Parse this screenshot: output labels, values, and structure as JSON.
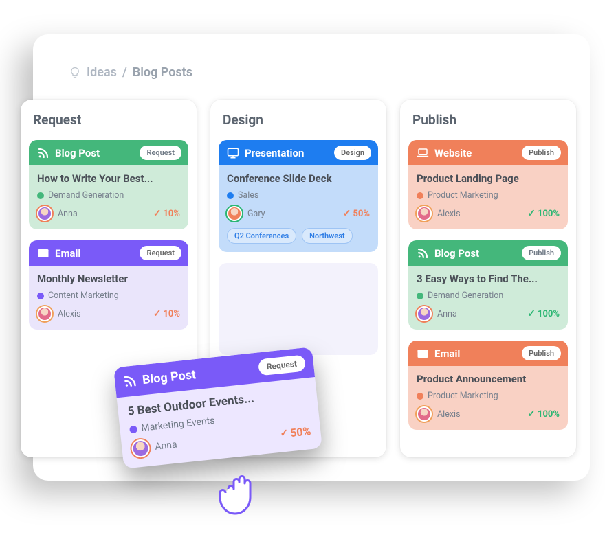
{
  "breadcrumb": {
    "root": "Ideas",
    "current": "Blog Posts"
  },
  "columns": [
    {
      "title": "Request"
    },
    {
      "title": "Design"
    },
    {
      "title": "Publish"
    }
  ],
  "cards": {
    "c0": {
      "type": "Blog Post",
      "stage": "Request",
      "title": "How to Write Your Best...",
      "category": "Demand Generation",
      "assignee": "Anna",
      "progress": "10%"
    },
    "c1": {
      "type": "Email",
      "stage": "Request",
      "title": "Monthly Newsletter",
      "category": "Content Marketing",
      "assignee": "Alexis",
      "progress": "10%"
    },
    "c2": {
      "type": "Presentation",
      "stage": "Design",
      "title": "Conference Slide Deck",
      "category": "Sales",
      "assignee": "Gary",
      "progress": "50%",
      "tags": [
        "Q2 Conferences",
        "Northwest"
      ]
    },
    "c3": {
      "type": "Website",
      "stage": "Publish",
      "title": "Product Landing Page",
      "category": "Product Marketing",
      "assignee": "Alexis",
      "progress": "100%"
    },
    "c4": {
      "type": "Blog Post",
      "stage": "Publish",
      "title": "3 Easy Ways to Find The...",
      "category": "Demand Generation",
      "assignee": "Anna",
      "progress": "100%"
    },
    "c5": {
      "type": "Email",
      "stage": "Publish",
      "title": "Product Announcement",
      "category": "Product Marketing",
      "assignee": "Alexis",
      "progress": "100%"
    },
    "drag": {
      "type": "Blog Post",
      "stage": "Request",
      "title": "5 Best Outdoor Events...",
      "category": "Marketing Events",
      "assignee": "Anna",
      "progress": "50%"
    }
  },
  "avatars": {
    "Anna": {
      "ring": "#F0805A",
      "bg": "#9B6AE0"
    },
    "Alexis": {
      "ring": "#F0A05A",
      "bg": "#E26B8A"
    },
    "Gary": {
      "ring": "#2BB673",
      "bg": "#F0805A"
    }
  }
}
